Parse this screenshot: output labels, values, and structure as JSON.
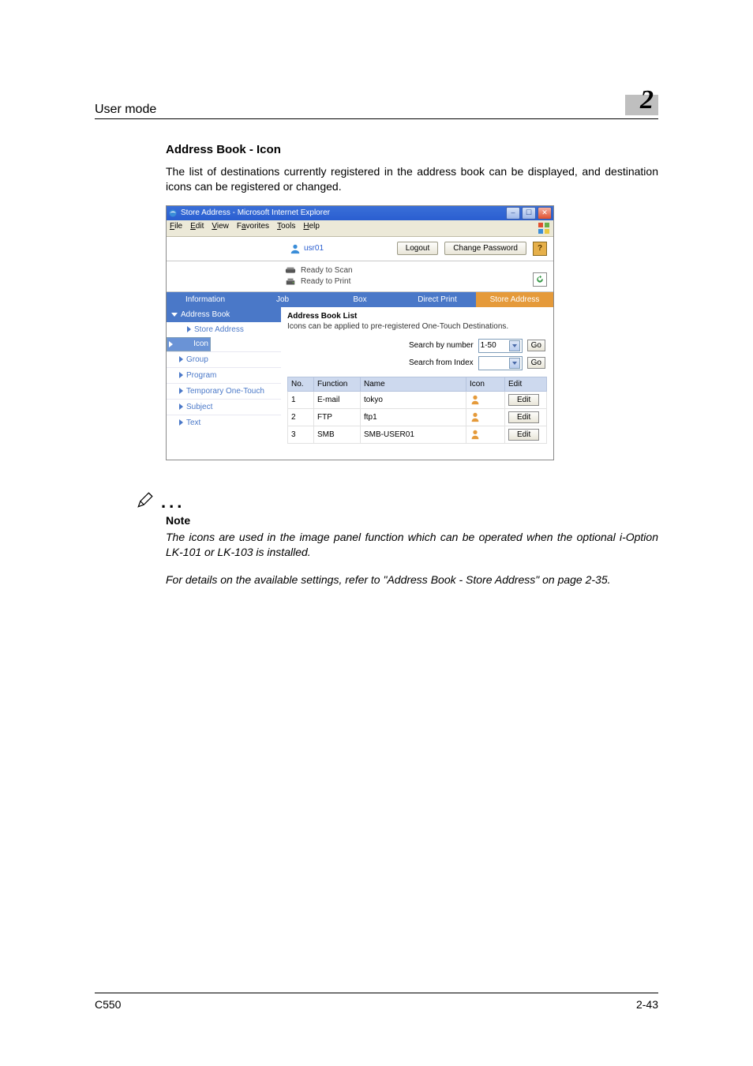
{
  "page": {
    "header_left": "User mode",
    "chapter_number": "2",
    "footer_left": "C550",
    "footer_right": "2-43"
  },
  "section_title": "Address Book - Icon",
  "lead_paragraph": "The list of destinations currently registered in the address book can be displayed, and destination icons can be registered or changed.",
  "screenshot": {
    "window_title": "Store Address - Microsoft Internet Explorer",
    "menus": {
      "file": "File",
      "edit": "Edit",
      "view": "View",
      "favorites": "Favorites",
      "tools": "Tools",
      "help": "Help"
    },
    "user_name": "usr01",
    "logout_btn": "Logout",
    "change_pw_btn": "Change Password",
    "help_label": "?",
    "status1": "Ready to Scan",
    "status2": "Ready to Print",
    "tabs": {
      "info": "Information",
      "job": "Job",
      "box": "Box",
      "direct": "Direct Print",
      "store": "Store Address"
    },
    "side": {
      "address_book": "Address Book",
      "store_address": "Store Address",
      "icon": "Icon",
      "group": "Group",
      "program": "Program",
      "temporary": "Temporary One-Touch",
      "subject": "Subject",
      "text": "Text"
    },
    "list_title": "Address Book List",
    "list_subtitle": "Icons can be applied to pre-registered One-Touch Destinations.",
    "search_number_label": "Search by number",
    "search_number_value": "1-50",
    "search_index_label": "Search from Index",
    "search_index_value": "",
    "go_label": "Go",
    "columns": {
      "no": "No.",
      "function": "Function",
      "name": "Name",
      "icon": "Icon",
      "edit": "Edit"
    },
    "rows": [
      {
        "no": "1",
        "function": "E-mail",
        "name": "tokyo",
        "edit": "Edit"
      },
      {
        "no": "2",
        "function": "FTP",
        "name": "ftp1",
        "edit": "Edit"
      },
      {
        "no": "3",
        "function": "SMB",
        "name": "SMB-USER01",
        "edit": "Edit"
      }
    ]
  },
  "note": {
    "title": "Note",
    "body1": "The icons are used in the image panel function which can be operated when the optional i-Option LK-101 or LK-103 is installed.",
    "body2": "For details on the available settings, refer to \"Address Book - Store Address\" on page 2-35."
  }
}
